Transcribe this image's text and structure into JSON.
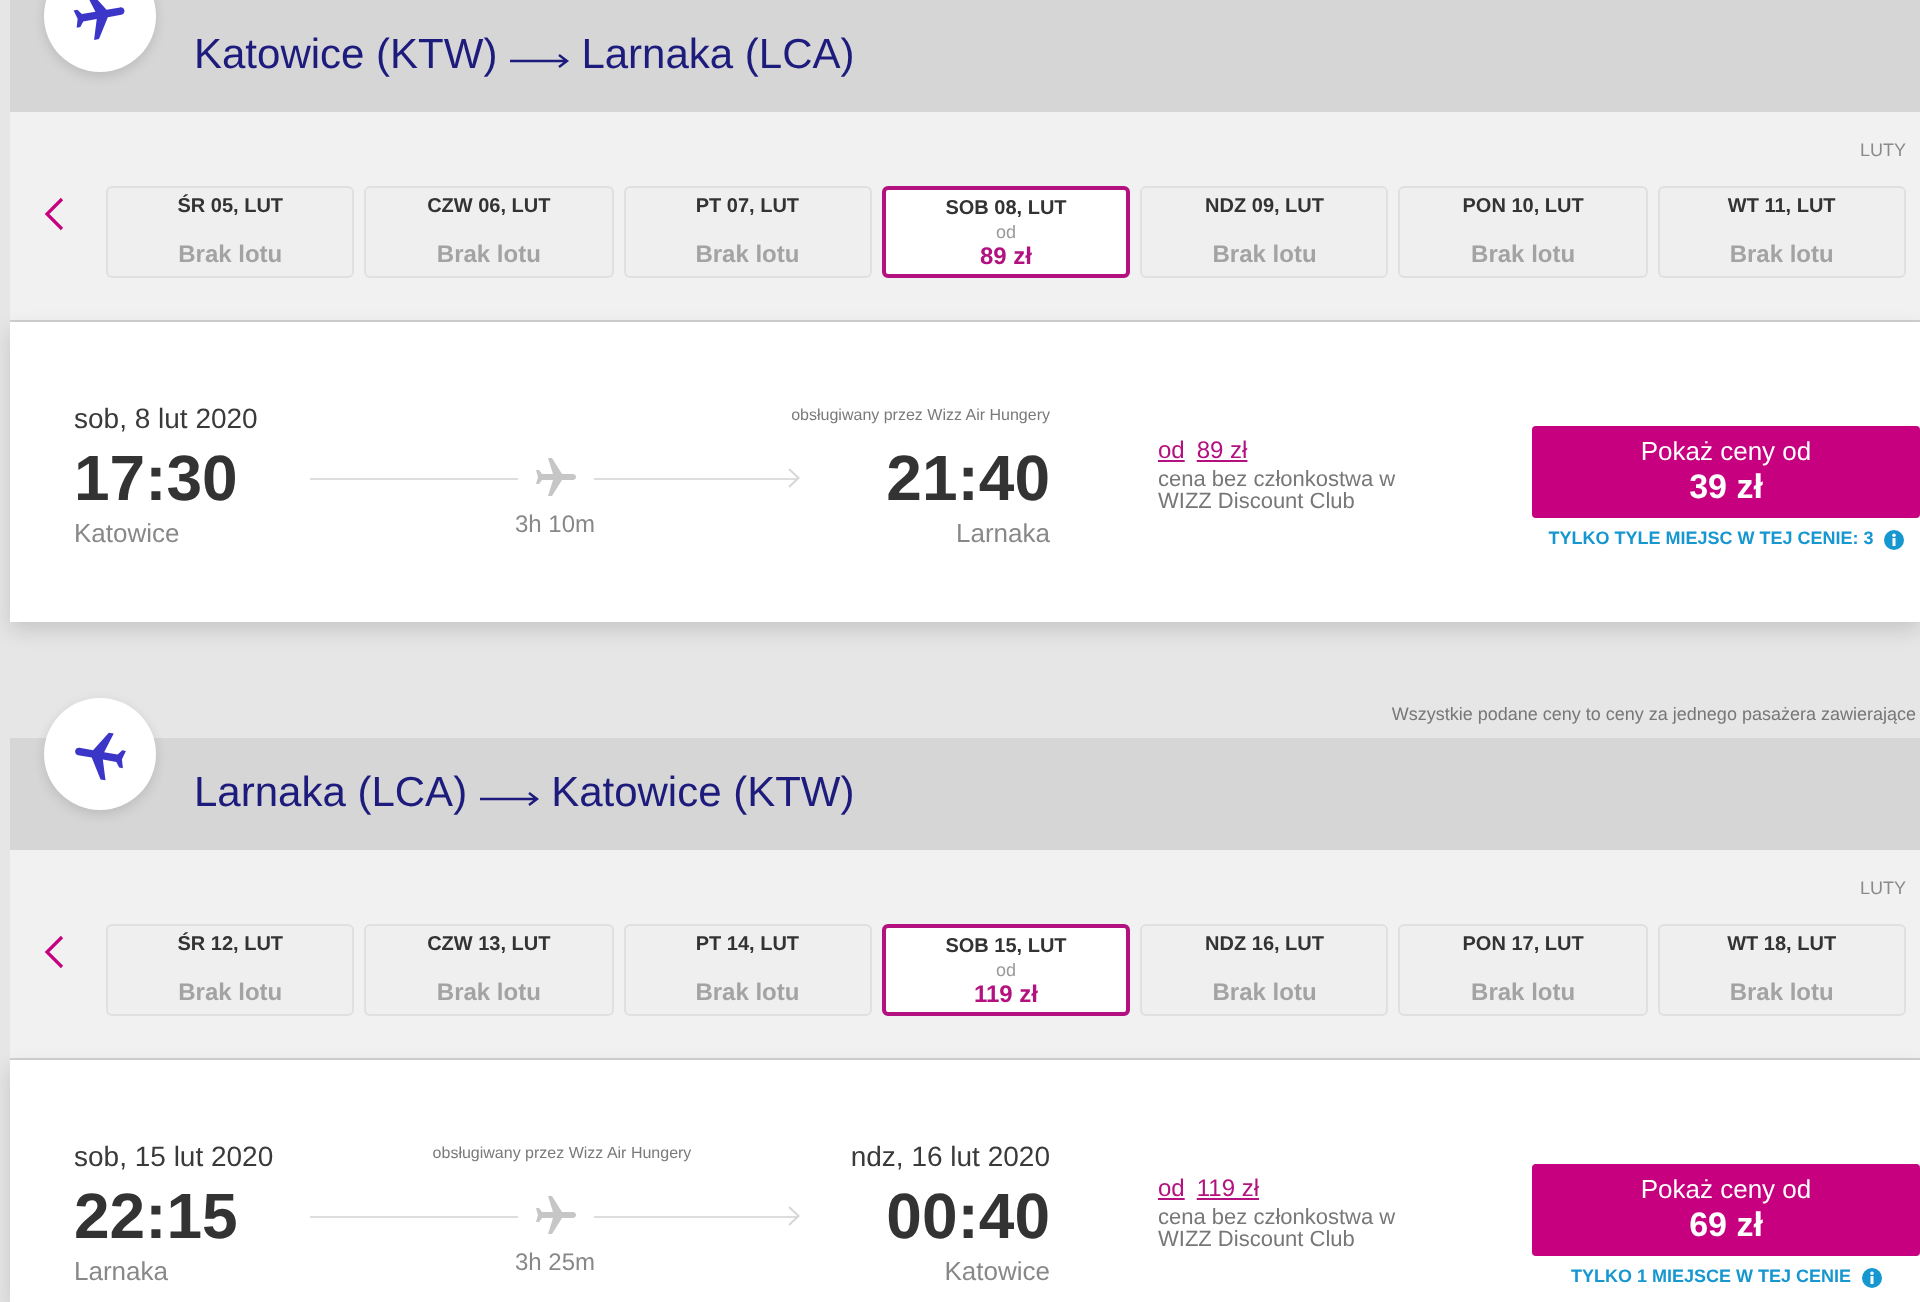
{
  "journeys": [
    {
      "kind": "outbound",
      "route": {
        "from": "Katowice (KTW)",
        "to": "Larnaka (LCA)"
      },
      "calendar": {
        "month": "LUTY",
        "days": [
          {
            "label": "ŚR 05, LUT",
            "status": "Brak lotu",
            "selected": false
          },
          {
            "label": "CZW 06, LUT",
            "status": "Brak lotu",
            "selected": false
          },
          {
            "label": "PT 07, LUT",
            "status": "Brak lotu",
            "selected": false
          },
          {
            "label": "SOB 08, LUT",
            "prefix": "od",
            "price": "89 zł",
            "selected": true
          },
          {
            "label": "NDZ 09, LUT",
            "status": "Brak lotu",
            "selected": false
          },
          {
            "label": "PON 10, LUT",
            "status": "Brak lotu",
            "selected": false
          },
          {
            "label": "WT 11, LUT",
            "status": "Brak lotu",
            "selected": false
          }
        ]
      },
      "flight": {
        "departure": {
          "date": "sob, 8 lut 2020",
          "time": "17:30",
          "city": "Katowice"
        },
        "operator": "obsługiwany przez Wizz Air Hungery",
        "duration": "3h 10m",
        "arrival": {
          "time": "21:40",
          "city": "Larnaka"
        },
        "regular_price": {
          "prefix": "od",
          "amount": "89 zł",
          "note": "cena bez członkostwa w WIZZ Discount Club"
        },
        "button": {
          "label": "Pokaż ceny od",
          "price": "39 zł"
        },
        "availability": "TYLKO TYLE MIEJSC W TEJ CENIE: 3"
      },
      "footnote": "Wszystkie podane ceny to ceny za jednego pasażera zawierające"
    },
    {
      "kind": "return",
      "route": {
        "from": "Larnaka (LCA)",
        "to": "Katowice (KTW)"
      },
      "calendar": {
        "month": "LUTY",
        "days": [
          {
            "label": "ŚR 12, LUT",
            "status": "Brak lotu",
            "selected": false
          },
          {
            "label": "CZW 13, LUT",
            "status": "Brak lotu",
            "selected": false
          },
          {
            "label": "PT 14, LUT",
            "status": "Brak lotu",
            "selected": false
          },
          {
            "label": "SOB 15, LUT",
            "prefix": "od",
            "price": "119 zł",
            "selected": true
          },
          {
            "label": "NDZ 16, LUT",
            "status": "Brak lotu",
            "selected": false
          },
          {
            "label": "PON 17, LUT",
            "status": "Brak lotu",
            "selected": false
          },
          {
            "label": "WT 18, LUT",
            "status": "Brak lotu",
            "selected": false
          }
        ]
      },
      "flight": {
        "departure": {
          "date": "sob, 15 lut 2020",
          "time": "22:15",
          "city": "Larnaka"
        },
        "operator": "obsługiwany przez Wizz Air Hungery",
        "duration": "3h 25m",
        "arrival": {
          "date": "ndz, 16 lut 2020",
          "time": "00:40",
          "city": "Katowice"
        },
        "regular_price": {
          "prefix": "od",
          "amount": "119 zł",
          "note": "cena bez członkostwa w WIZZ Discount Club"
        },
        "button": {
          "label": "Pokaż ceny od",
          "price": "69 zł"
        },
        "availability": "TYLKO 1 MIEJSCE W TEJ CENIE"
      }
    }
  ]
}
